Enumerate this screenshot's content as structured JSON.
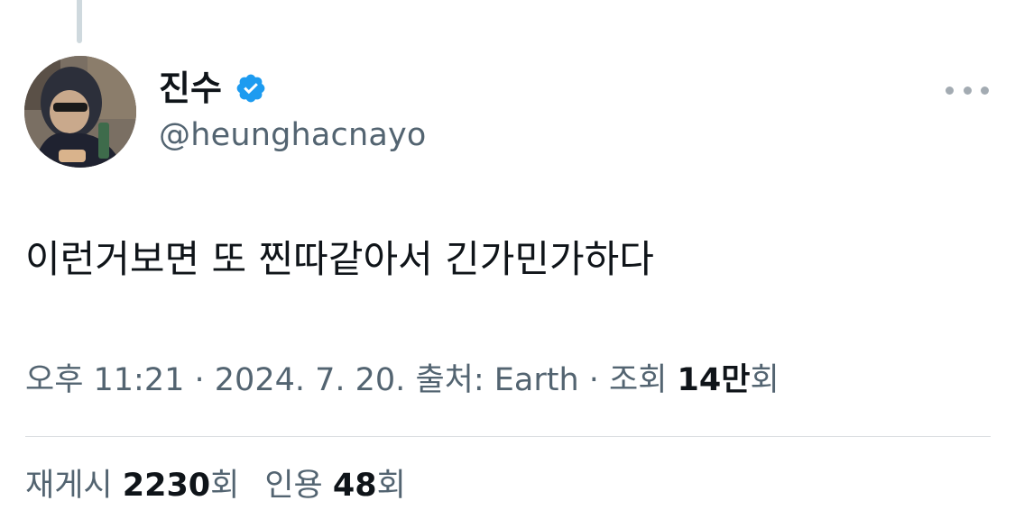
{
  "tweet": {
    "author": {
      "display_name": "진수",
      "handle": "@heunghacnayo",
      "verified": true
    },
    "text": "이런거보면 또 찐따같아서 긴가민가하다",
    "meta": {
      "time": "오후 11:21",
      "separator": " · ",
      "date": "2024. 7. 20.",
      "source_label": "출처: ",
      "source": "Earth",
      "views_label": "조회 ",
      "views_count": "14만",
      "views_suffix": "회"
    },
    "stats": {
      "retweets_label": "재게시 ",
      "retweets_count": "2230",
      "retweets_suffix": "회",
      "quotes_label": "인용 ",
      "quotes_count": "48",
      "quotes_suffix": "회"
    }
  },
  "icons": {
    "verified": "verified-badge-icon",
    "more": "more-options-icon"
  },
  "colors": {
    "verified_blue": "#1d9bf0",
    "secondary_text": "#536471",
    "primary_text": "#0f1419",
    "divider": "#d9dde0"
  }
}
